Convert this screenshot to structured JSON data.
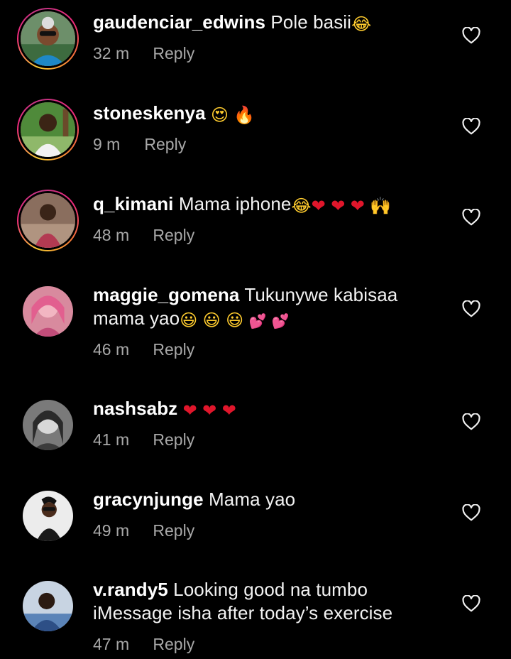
{
  "comments": [
    {
      "username": "gaudenciar_edwins",
      "text": "Pole basii",
      "emojis": [
        "😂"
      ],
      "time": "32 m",
      "reply": "Reply"
    },
    {
      "username": "stoneskenya",
      "text": "",
      "emojis": [
        "😍",
        "🔥"
      ],
      "time": "9 m",
      "reply": "Reply"
    },
    {
      "username": "q_kimani",
      "text": "Mama iphone",
      "emojis": [
        "😂",
        "❤",
        "❤",
        "❤",
        "🙌"
      ],
      "time": "48 m",
      "reply": "Reply"
    },
    {
      "username": "maggie_gomena",
      "text": "Tukunywe kabisaa mama yao",
      "emojis": [
        "😃",
        "😃",
        "😃",
        "💕",
        "💕"
      ],
      "time": "46 m",
      "reply": "Reply"
    },
    {
      "username": "nashsabz",
      "text": "",
      "emojis": [
        "❤",
        "❤",
        "❤"
      ],
      "time": "41 m",
      "reply": "Reply"
    },
    {
      "username": "gracynjunge",
      "text": "Mama yao",
      "emojis": [],
      "time": "49 m",
      "reply": "Reply"
    },
    {
      "username": "v.randy5",
      "text": "Looking good na tumbo iMessage isha after today’s exercise",
      "emojis": [],
      "time": "47 m",
      "reply": "Reply"
    }
  ],
  "icons": {
    "like": "heart-outline-icon"
  },
  "colors": {
    "background": "#000000",
    "meta": "#a8a8a8",
    "story_ring": "#ee2a7b"
  }
}
